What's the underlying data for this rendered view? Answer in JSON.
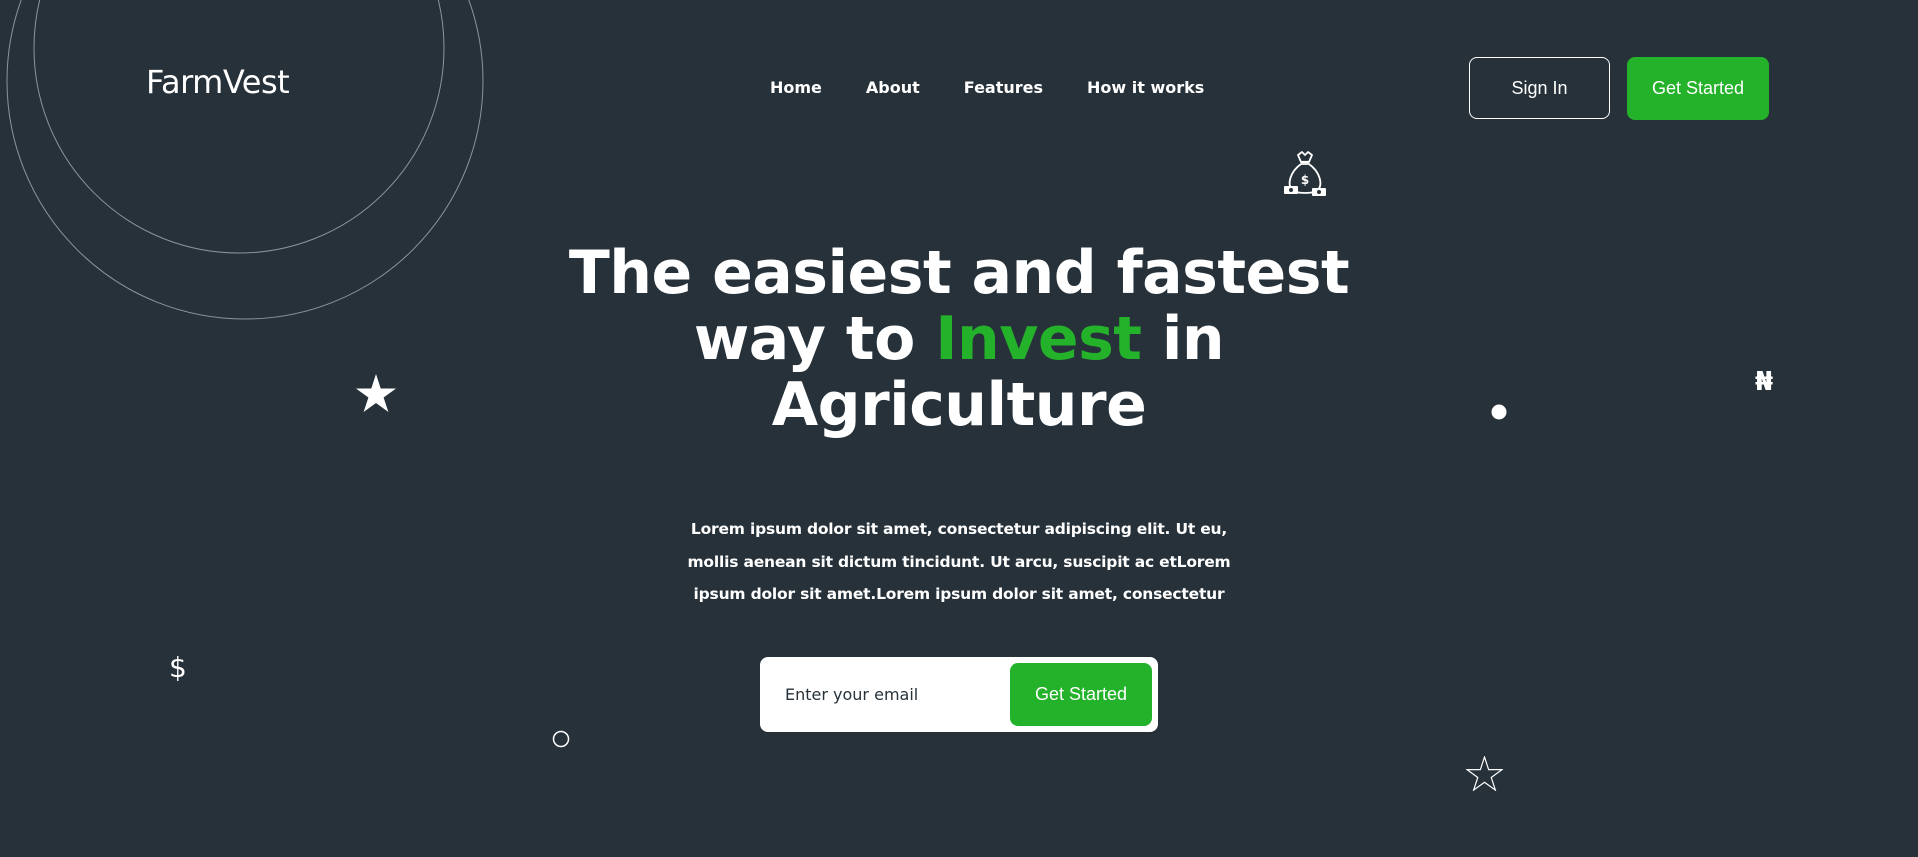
{
  "brand": {
    "name": "FarmVest"
  },
  "nav": {
    "items": [
      {
        "label": "Home"
      },
      {
        "label": "About"
      },
      {
        "label": "Features"
      },
      {
        "label": "How it works"
      }
    ]
  },
  "header": {
    "signin_label": "Sign In",
    "get_started_label": "Get Started"
  },
  "hero": {
    "title_part1": "The easiest and fastest way to",
    "title_accent": "Invest",
    "title_part2": "in Agriculture",
    "description": "Lorem ipsum dolor sit amet, consectetur adipiscing elit. Ut eu, mollis aenean sit dictum tincidunt. Ut arcu, suscipit ac etLorem ipsum dolor sit amet.Lorem ipsum dolor sit amet, consectetur"
  },
  "signup_form": {
    "email_placeholder": "Enter your email",
    "submit_label": "Get Started"
  },
  "decorations": {
    "dollar_glyph": "$",
    "naira_glyph": "₦",
    "icons": [
      "money-bag-icon",
      "star-filled-icon",
      "star-outline-icon",
      "dot-icon",
      "circle-outline-icon",
      "dollar-icon",
      "naira-icon"
    ]
  },
  "colors": {
    "background": "#263139",
    "accent": "#24b22b",
    "text": "#ffffff"
  }
}
